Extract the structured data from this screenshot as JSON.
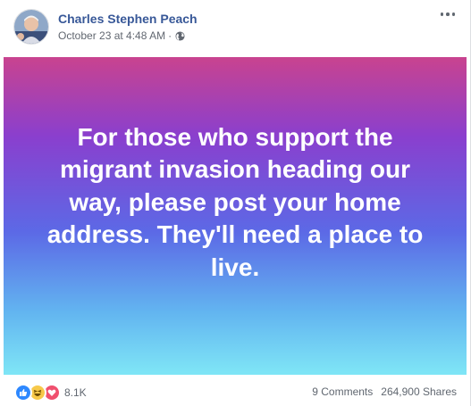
{
  "post": {
    "author": "Charles Stephen Peach",
    "timestamp": "October 23 at 4:48 AM",
    "separator": "·",
    "privacy_icon": "globe-icon",
    "more_icon": "more-options-icon",
    "text": "For those who support the migrant invasion heading our way, please post your home address. They'll need a place to live.",
    "background_colors": [
      "#c9438f",
      "#8a3fce",
      "#5c69e6",
      "#62b4f0",
      "#7fe6f6"
    ]
  },
  "footer": {
    "reaction_icons": [
      "like-icon",
      "haha-icon",
      "love-icon"
    ],
    "reaction_count": "8.1K",
    "comments": "9 Comments",
    "shares": "264,900 Shares"
  },
  "colors": {
    "author_link": "#385898",
    "meta_text": "#616770",
    "like": "#2d88ff",
    "haha": "#f7c94a",
    "love": "#f0506e"
  }
}
